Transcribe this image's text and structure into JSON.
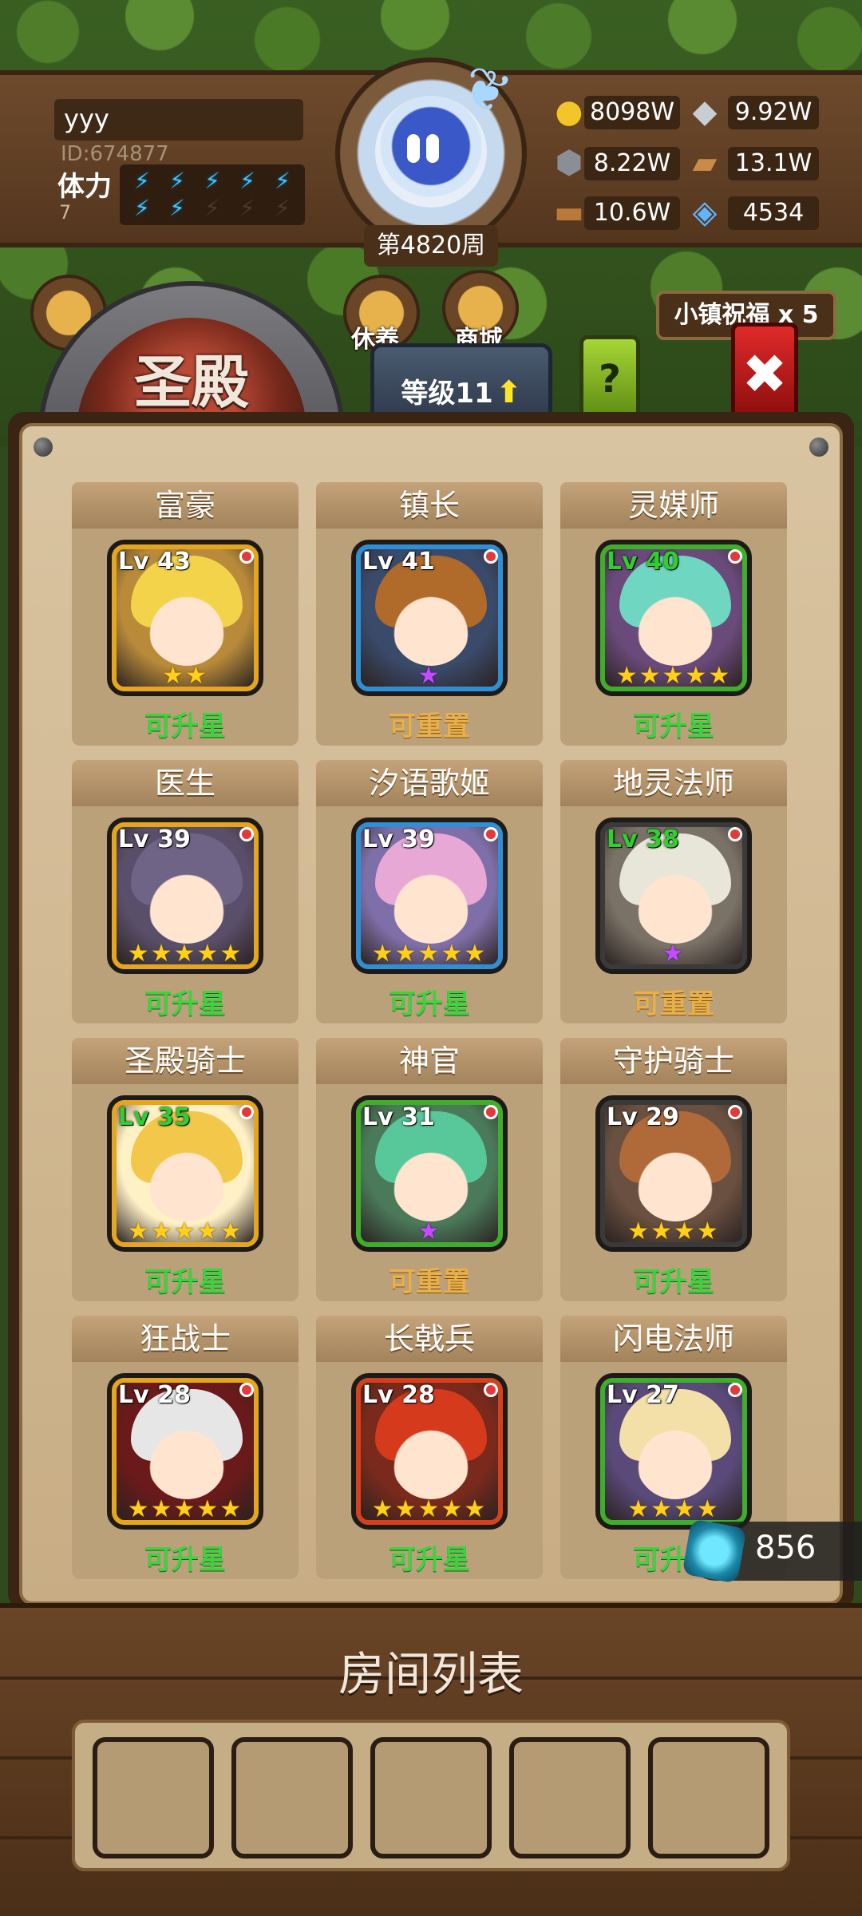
{
  "player": {
    "name": "yyy",
    "id": "ID:674877",
    "stamina_label": "体力",
    "stamina_value": "7",
    "stamina_full": 7,
    "stamina_max": 10
  },
  "week": "第4820周",
  "resources": [
    {
      "icon": "gold-coin-icon",
      "value": "8098W"
    },
    {
      "icon": "iron-ingot-icon",
      "value": "9.92W"
    },
    {
      "icon": "stone-ore-icon",
      "value": "8.22W"
    },
    {
      "icon": "cloth-icon",
      "value": "13.1W"
    },
    {
      "icon": "wood-log-icon",
      "value": "10.6W"
    },
    {
      "icon": "crystal-gem-icon",
      "value": "4534"
    }
  ],
  "shop_labels": {
    "rest": "休养",
    "store": "商城"
  },
  "blessing": "小镇祝福 x 5",
  "title": "圣殿",
  "level_tab": "等级11",
  "help": "?",
  "heroes": [
    {
      "name": "富豪",
      "level": "Lv 43",
      "lv_green": false,
      "frame": "#e5a51c",
      "bg": "#b88a3a",
      "hair": "#f2d34a",
      "stars": "★★",
      "star_purple": false,
      "status": "可升星",
      "status_color": "green"
    },
    {
      "name": "镇长",
      "level": "Lv 41",
      "lv_green": false,
      "frame": "#2f8fd6",
      "bg": "#3a4a6a",
      "hair": "#b06a2a",
      "stars": "★",
      "star_purple": true,
      "status": "可重置",
      "status_color": "orange"
    },
    {
      "name": "灵媒师",
      "level": "Lv 40",
      "lv_green": true,
      "frame": "#3fae2a",
      "bg": "#6a4a7a",
      "hair": "#6fd6c2",
      "stars": "★★★★★",
      "star_purple": false,
      "status": "可升星",
      "status_color": "green"
    },
    {
      "name": "医生",
      "level": "Lv 39",
      "lv_green": false,
      "frame": "#e5a51c",
      "bg": "#5a4f6a",
      "hair": "#6f6486",
      "stars": "★★★★★",
      "star_purple": false,
      "status": "可升星",
      "status_color": "green"
    },
    {
      "name": "汐语歌姬",
      "level": "Lv 39",
      "lv_green": false,
      "frame": "#2f8fd6",
      "bg": "#7f6fa8",
      "hair": "#e7a8d6",
      "stars": "★★★★★",
      "star_purple": false,
      "status": "可升星",
      "status_color": "green"
    },
    {
      "name": "地灵法师",
      "level": "Lv 38",
      "lv_green": true,
      "frame": "#3a3a3a",
      "bg": "#7a7266",
      "hair": "#e8e5d9",
      "stars": "★",
      "star_purple": true,
      "status": "可重置",
      "status_color": "orange"
    },
    {
      "name": "圣殿骑士",
      "level": "Lv 35",
      "lv_green": true,
      "frame": "#e5a51c",
      "bg": "#fff1c6",
      "hair": "#f2c74a",
      "stars": "★★★★★",
      "star_purple": false,
      "status": "可升星",
      "status_color": "green"
    },
    {
      "name": "神官",
      "level": "Lv 31",
      "lv_green": false,
      "frame": "#3fae2a",
      "bg": "#4b7a5a",
      "hair": "#58c79a",
      "stars": "★",
      "star_purple": true,
      "status": "可重置",
      "status_color": "orange"
    },
    {
      "name": "守护骑士",
      "level": "Lv 29",
      "lv_green": false,
      "frame": "#3a3a3a",
      "bg": "#6a5040",
      "hair": "#b06a3a",
      "stars": "★★★★",
      "star_purple": false,
      "status": "可升星",
      "status_color": "green"
    },
    {
      "name": "狂战士",
      "level": "Lv 28",
      "lv_green": false,
      "frame": "#e5a51c",
      "bg": "#6a1a1a",
      "hair": "#e6e6e6",
      "stars": "★★★★★",
      "star_purple": false,
      "status": "可升星",
      "status_color": "green"
    },
    {
      "name": "长戟兵",
      "level": "Lv 28",
      "lv_green": false,
      "frame": "#d6401c",
      "bg": "#7a2a1c",
      "hair": "#d63a1c",
      "stars": "★★★★★",
      "star_purple": false,
      "status": "可升星",
      "status_color": "green"
    },
    {
      "name": "闪电法师",
      "level": "Lv 27",
      "lv_green": false,
      "frame": "#3fae2a",
      "bg": "#5a4a7a",
      "hair": "#f2e0a8",
      "stars": "★★★★",
      "star_purple": false,
      "status": "可升星",
      "status_color": "green"
    }
  ],
  "gem_counter": "856",
  "room_title": "房间列表",
  "room_slots": 5
}
